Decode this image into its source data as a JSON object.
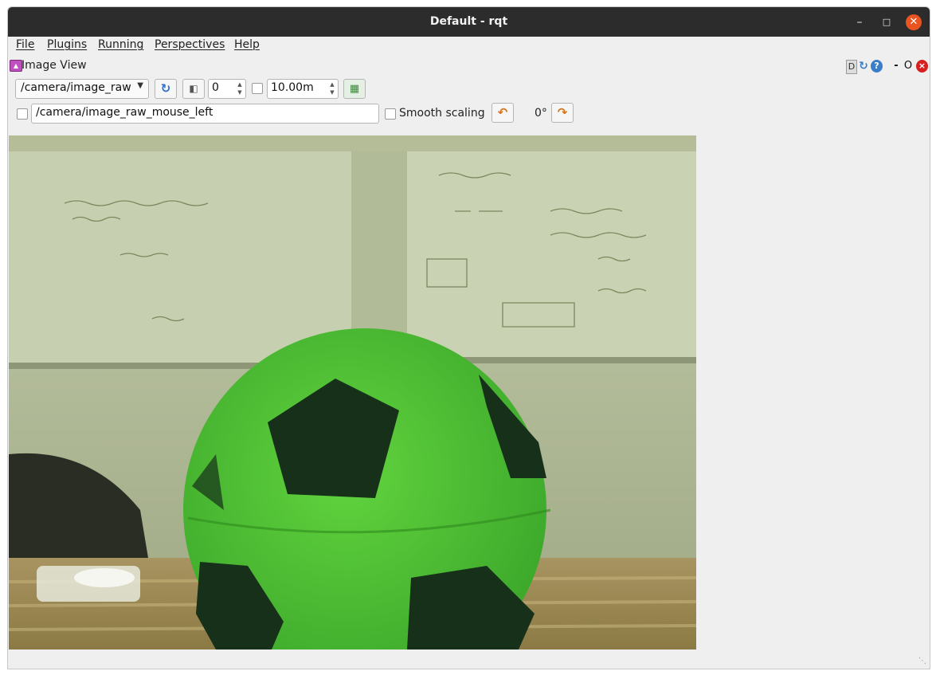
{
  "window": {
    "title": "Default - rqt"
  },
  "menubar": {
    "items": [
      "File",
      "Plugins",
      "Running",
      "Perspectives",
      "Help"
    ]
  },
  "plugin": {
    "title": "Image View",
    "header_buttons": {
      "d": "D",
      "minimize": "-",
      "float": "O"
    }
  },
  "toolbar": {
    "topic": "/camera/image_raw",
    "frame_value": "0",
    "time_value": "10.00m",
    "mouse_topic": "/camera/image_raw_mouse_left",
    "smooth_label": "Smooth scaling",
    "rotation": "0°"
  },
  "image": {
    "description_icon": "camera-frame-soccer-ball",
    "colors": {
      "ball_green": "#4fc232",
      "ball_dark": "#17301a",
      "whiteboard": "#b7c19e",
      "table": "#9a8752"
    }
  },
  "colors": {
    "titlebar": "#2c2c2c",
    "close": "#e95420",
    "accent": "#2f6fd0"
  }
}
